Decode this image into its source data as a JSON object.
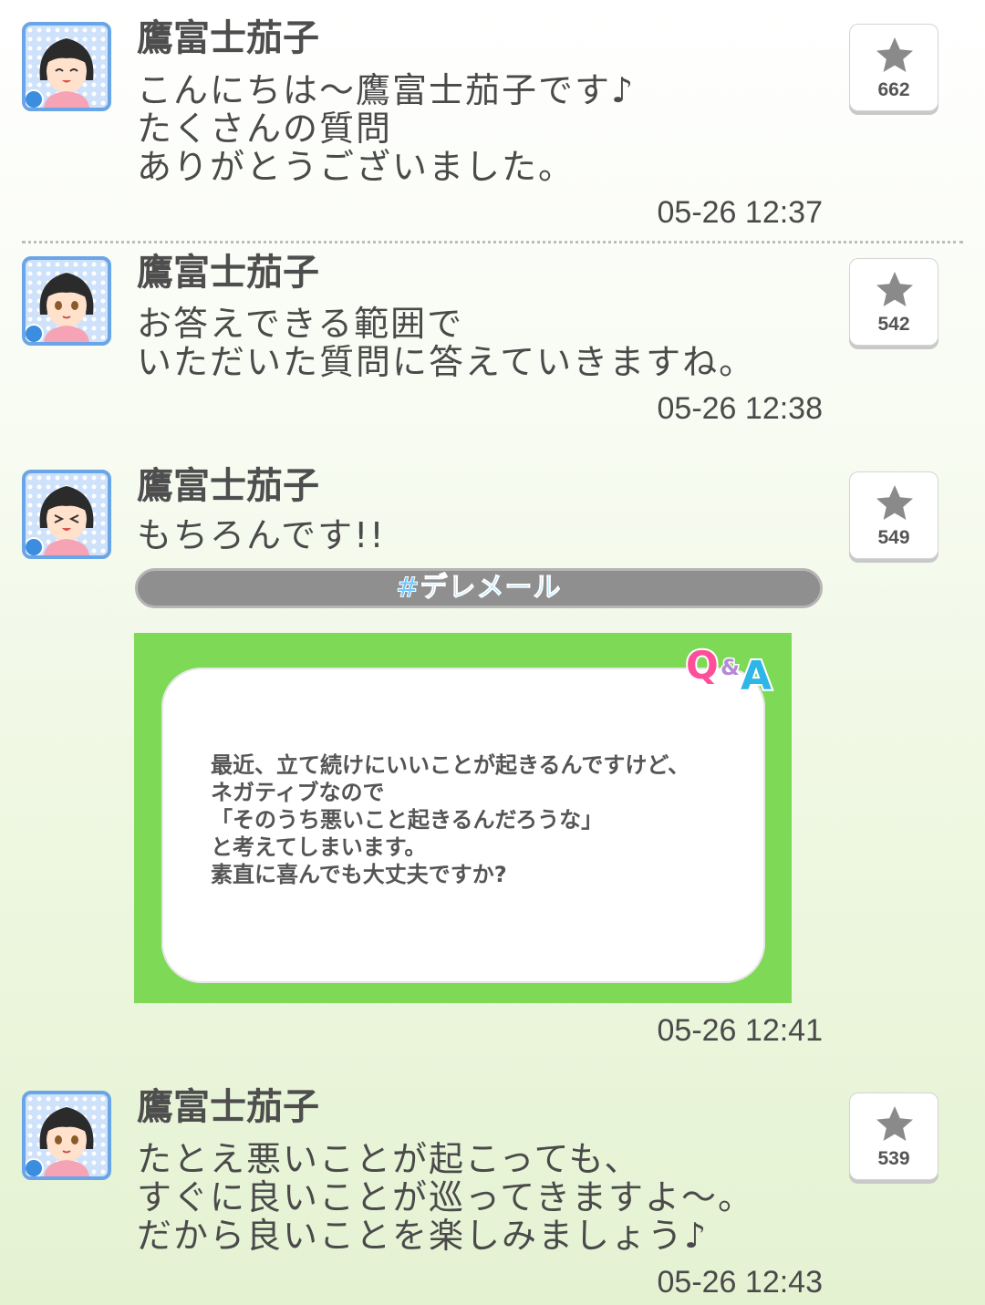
{
  "posts": [
    {
      "name": "鷹富士茄子",
      "text": "こんにちは～鷹富士茄子です♪\nたくさんの質問\nありがとうございました。",
      "time": "05-26 12:37",
      "likes": "662",
      "expression": "laughing"
    },
    {
      "name": "鷹富士茄子",
      "text": "お答えできる範囲で\nいただいた質問に答えていきますね。",
      "time": "05-26 12:38",
      "likes": "542",
      "expression": "smile"
    },
    {
      "name": "鷹富士茄子",
      "text": "もちろんです!!",
      "time": "05-26 12:41",
      "likes": "549",
      "expression": "excited"
    },
    {
      "name": "鷹富士茄子",
      "text": "たとえ悪いことが起こっても、\nすぐに良いことが巡ってきますよ～。\nだから良いことを楽しみましょう♪",
      "time": "05-26 12:43",
      "likes": "539",
      "expression": "smile"
    }
  ],
  "hashtag": "#デレメール",
  "qa": {
    "logo": "Q&A",
    "question": "最近、立て続けにいいことが起きるんですけど、\nネガティブなので\n「そのうち悪いこと起きるんだろうな」\nと考えてしまいます。\n素直に喜んでも大丈夫ですか?"
  },
  "colors": {
    "avatar_border": "#6aa5e8",
    "qa_green": "#7ed957",
    "tag_bar": "#8f8f8f",
    "tag_text": "#6cc8ff"
  },
  "icons": [
    "star-icon",
    "diamond-icon",
    "avatar"
  ]
}
